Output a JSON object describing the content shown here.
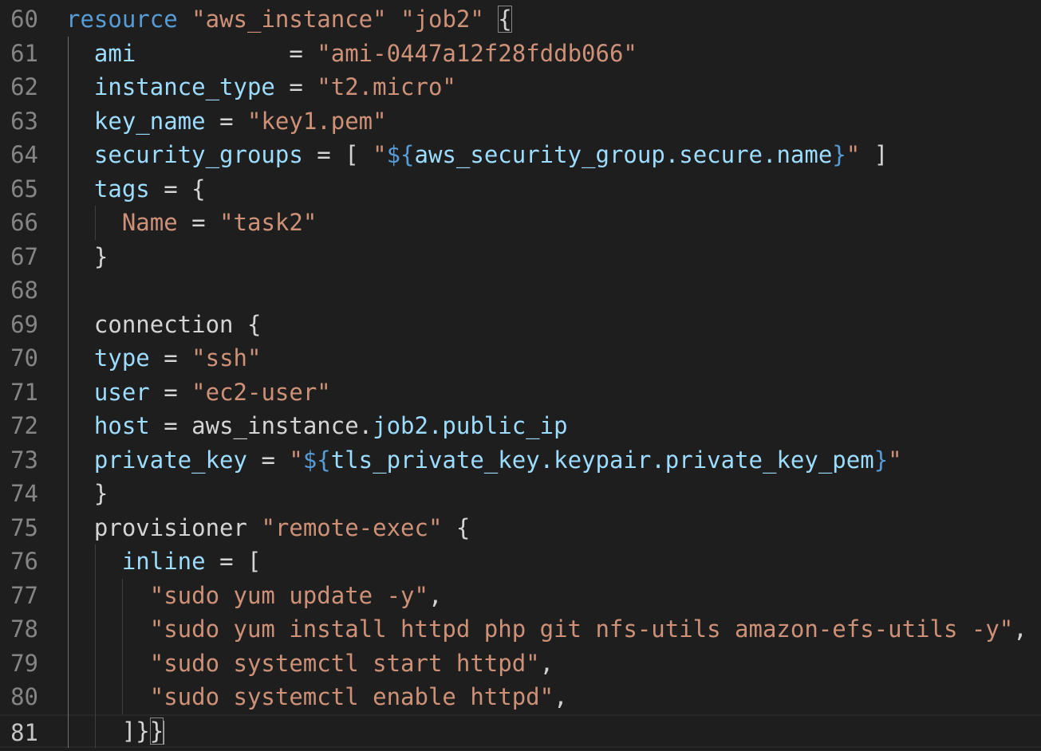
{
  "editor": {
    "language": "terraform",
    "colors": {
      "background": "#1e1e1e",
      "line_number": "#858585",
      "keyword": "#569cd6",
      "string": "#ce9178",
      "property": "#9cdcfe",
      "text": "#d4d4d4"
    },
    "lines": [
      {
        "num": "60",
        "tokens": [
          {
            "t": "resource",
            "c": "k"
          },
          {
            "t": " ",
            "c": "t"
          },
          {
            "t": "\"aws_instance\"",
            "c": "s"
          },
          {
            "t": " ",
            "c": "t"
          },
          {
            "t": "\"job2\"",
            "c": "s"
          },
          {
            "t": " ",
            "c": "t"
          },
          {
            "t": "{",
            "c": "t b"
          }
        ]
      },
      {
        "num": "61",
        "tokens": [
          {
            "t": "  ami",
            "c": "p"
          },
          {
            "t": "           = ",
            "c": "t"
          },
          {
            "t": "\"ami-0447a12f28fddb066\"",
            "c": "s"
          }
        ]
      },
      {
        "num": "62",
        "tokens": [
          {
            "t": "  instance_type",
            "c": "p"
          },
          {
            "t": " = ",
            "c": "t"
          },
          {
            "t": "\"t2.micro\"",
            "c": "s"
          }
        ]
      },
      {
        "num": "63",
        "tokens": [
          {
            "t": "  key_name",
            "c": "p"
          },
          {
            "t": " = ",
            "c": "t"
          },
          {
            "t": "\"key1.pem\"",
            "c": "s"
          }
        ]
      },
      {
        "num": "64",
        "tokens": [
          {
            "t": "  security_groups",
            "c": "p"
          },
          {
            "t": " = [ ",
            "c": "t"
          },
          {
            "t": "\"",
            "c": "s"
          },
          {
            "t": "${",
            "c": "i"
          },
          {
            "t": "aws_security_group.secure.name",
            "c": "p"
          },
          {
            "t": "}",
            "c": "i"
          },
          {
            "t": "\"",
            "c": "s"
          },
          {
            "t": " ]",
            "c": "t"
          }
        ]
      },
      {
        "num": "65",
        "tokens": [
          {
            "t": "  tags",
            "c": "p"
          },
          {
            "t": " = {",
            "c": "t"
          }
        ]
      },
      {
        "num": "66",
        "tokens": [
          {
            "t": "    Name",
            "c": "s"
          },
          {
            "t": " = ",
            "c": "t"
          },
          {
            "t": "\"task2\"",
            "c": "s"
          }
        ]
      },
      {
        "num": "67",
        "tokens": [
          {
            "t": "  }",
            "c": "t"
          }
        ]
      },
      {
        "num": "68",
        "tokens": []
      },
      {
        "num": "69",
        "tokens": [
          {
            "t": "  connection",
            "c": "t"
          },
          {
            "t": " {",
            "c": "t"
          }
        ]
      },
      {
        "num": "70",
        "tokens": [
          {
            "t": "  type",
            "c": "p"
          },
          {
            "t": " = ",
            "c": "t"
          },
          {
            "t": "\"ssh\"",
            "c": "s"
          }
        ]
      },
      {
        "num": "71",
        "tokens": [
          {
            "t": "  user",
            "c": "p"
          },
          {
            "t": " = ",
            "c": "t"
          },
          {
            "t": "\"ec2-user\"",
            "c": "s"
          }
        ]
      },
      {
        "num": "72",
        "tokens": [
          {
            "t": "  host",
            "c": "p"
          },
          {
            "t": " = aws_instance.",
            "c": "t"
          },
          {
            "t": "job2.public_ip",
            "c": "p"
          }
        ]
      },
      {
        "num": "73",
        "tokens": [
          {
            "t": "  private_key",
            "c": "p"
          },
          {
            "t": " = ",
            "c": "t"
          },
          {
            "t": "\"",
            "c": "s"
          },
          {
            "t": "${",
            "c": "i"
          },
          {
            "t": "tls_private_key.keypair.private_key_pem",
            "c": "p"
          },
          {
            "t": "}",
            "c": "i"
          },
          {
            "t": "\"",
            "c": "s"
          }
        ]
      },
      {
        "num": "74",
        "tokens": [
          {
            "t": "  }",
            "c": "t"
          }
        ]
      },
      {
        "num": "75",
        "tokens": [
          {
            "t": "  provisioner",
            "c": "t"
          },
          {
            "t": " ",
            "c": "t"
          },
          {
            "t": "\"remote-exec\"",
            "c": "s"
          },
          {
            "t": " {",
            "c": "t"
          }
        ]
      },
      {
        "num": "76",
        "tokens": [
          {
            "t": "    inline",
            "c": "p"
          },
          {
            "t": " = [",
            "c": "t"
          }
        ]
      },
      {
        "num": "77",
        "tokens": [
          {
            "t": "      \"sudo yum update -y\"",
            "c": "s"
          },
          {
            "t": ",",
            "c": "t"
          }
        ]
      },
      {
        "num": "78",
        "tokens": [
          {
            "t": "      \"sudo yum install httpd php git nfs-utils amazon-efs-utils -y\"",
            "c": "s"
          },
          {
            "t": ",",
            "c": "t"
          }
        ]
      },
      {
        "num": "79",
        "tokens": [
          {
            "t": "      \"sudo systemctl start httpd\"",
            "c": "s"
          },
          {
            "t": ",",
            "c": "t"
          }
        ]
      },
      {
        "num": "80",
        "tokens": [
          {
            "t": "      \"sudo systemctl enable httpd\"",
            "c": "s"
          },
          {
            "t": ",",
            "c": "t"
          }
        ]
      },
      {
        "num": "81",
        "tokens": [
          {
            "t": "    ]}",
            "c": "t"
          },
          {
            "t": "}",
            "c": "t b"
          }
        ],
        "current": true
      }
    ]
  }
}
